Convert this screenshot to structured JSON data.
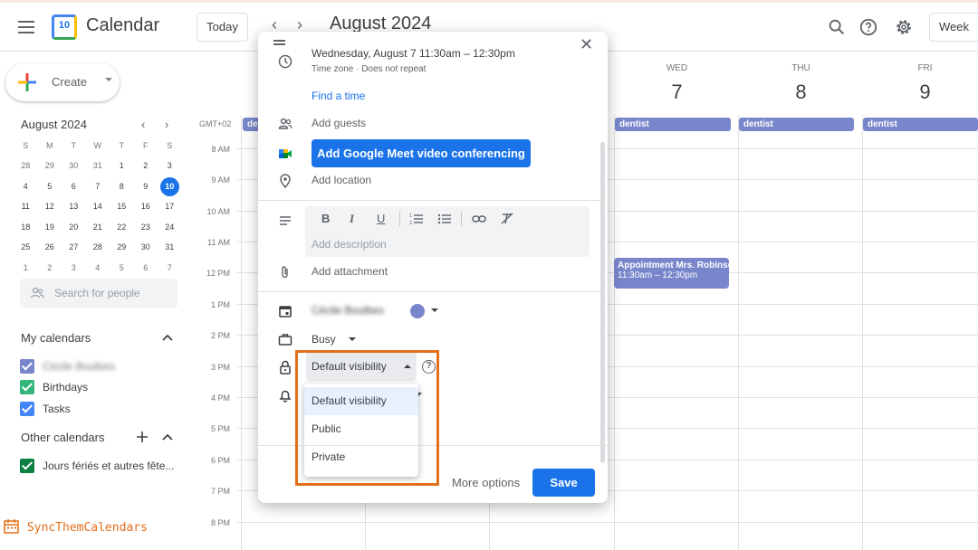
{
  "header": {
    "app_title": "Calendar",
    "logo_day": "10",
    "today_label": "Today",
    "prev_icon": "‹",
    "next_icon": "›",
    "month_title": "August 2024",
    "week_label": "Week",
    "icons": [
      "menu-icon",
      "search-icon",
      "help-icon",
      "settings-icon"
    ]
  },
  "sidebar": {
    "create_label": "Create",
    "mini_calendar": {
      "title": "August 2024",
      "weekdays": [
        "S",
        "M",
        "T",
        "W",
        "T",
        "F",
        "S"
      ],
      "weeks": [
        [
          "28",
          "29",
          "30",
          "31",
          "1",
          "2",
          "3"
        ],
        [
          "4",
          "5",
          "6",
          "7",
          "8",
          "9",
          "10"
        ],
        [
          "11",
          "12",
          "13",
          "14",
          "15",
          "16",
          "17"
        ],
        [
          "18",
          "19",
          "20",
          "21",
          "22",
          "23",
          "24"
        ],
        [
          "25",
          "26",
          "27",
          "28",
          "29",
          "30",
          "31"
        ],
        [
          "1",
          "2",
          "3",
          "4",
          "5",
          "6",
          "7"
        ]
      ],
      "today": "10"
    },
    "search_people_placeholder": "Search for people",
    "my_calendars_title": "My calendars",
    "my_calendars": [
      {
        "label": "Cécile Boulbes",
        "color": "#7986cb",
        "blurred": true
      },
      {
        "label": "Birthdays",
        "color": "#33b679"
      },
      {
        "label": "Tasks",
        "color": "#4285f4"
      }
    ],
    "other_calendars_title": "Other calendars",
    "other_calendars": [
      {
        "label": "Jours fériés et autres fête...",
        "color": "#0b8043"
      }
    ]
  },
  "grid": {
    "gmt": "GMT+02",
    "days": [
      {
        "dow": "WED",
        "num": "7"
      },
      {
        "dow": "THU",
        "num": "8"
      },
      {
        "dow": "FRI",
        "num": "9"
      }
    ],
    "allday_label": "dentist",
    "allday_partial": "der",
    "times": [
      "8 AM",
      "9 AM",
      "10 AM",
      "11 AM",
      "12 PM",
      "1 PM",
      "2 PM",
      "3 PM",
      "4 PM",
      "5 PM",
      "6 PM",
      "7 PM",
      "8 PM"
    ],
    "event": {
      "title": "Appointment Mrs. Robinson",
      "time": "11:30am – 12:30pm",
      "color": "#7986cb"
    }
  },
  "dialog": {
    "date_line": "Wednesday, August 7   11:30am  –  12:30pm",
    "timezone_line": "Time zone · Does not repeat",
    "find_time": "Find a time",
    "add_guests": "Add guests",
    "meet_button": "Add Google Meet video conferencing",
    "add_location": "Add location",
    "toolbar": [
      "B",
      "I",
      "U"
    ],
    "description_placeholder": "Add description",
    "add_attachment": "Add attachment",
    "calendar_owner": "Cécile Boulbes",
    "busy": "Busy",
    "visibility_selected": "Default visibility",
    "visibility_options": [
      "Default visibility",
      "Public",
      "Private"
    ],
    "more_options": "More options",
    "save": "Save"
  },
  "brand": "SyncThemCalendars",
  "colors": {
    "accent": "#1a73e8",
    "event": "#7986cb",
    "highlight": "#e46f1a"
  }
}
